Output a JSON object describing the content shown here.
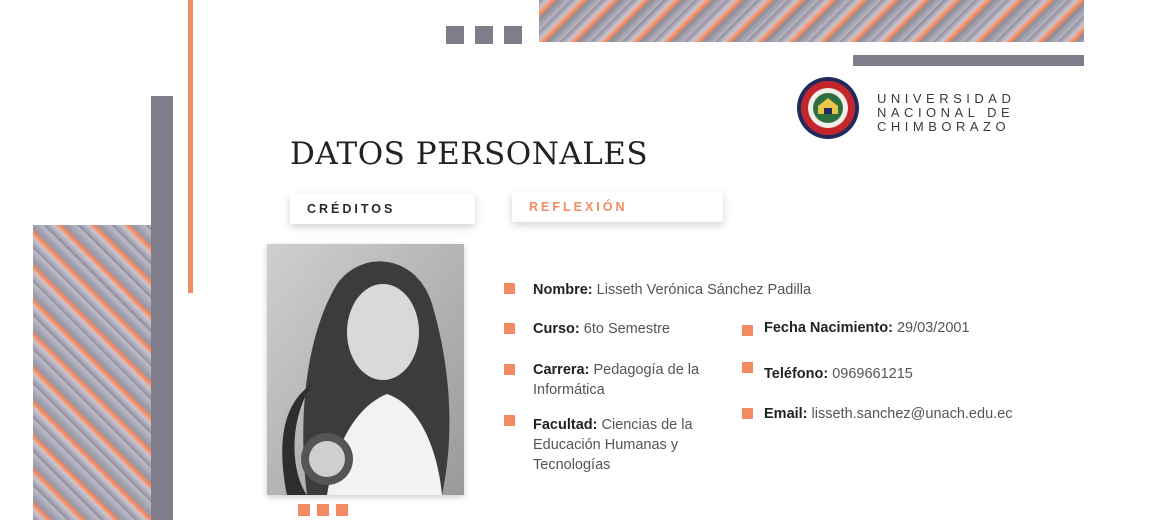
{
  "header": {
    "title": "DATOS PERSONALES",
    "university_line1": "UNIVERSIDAD",
    "university_line2": "NACIONAL DE",
    "university_line3": "CHIMBORAZO",
    "logo_icon": "university-seal-icon"
  },
  "tabs": [
    {
      "label": "CRÉDITOS",
      "active": false
    },
    {
      "label": "REFLEXIÓN",
      "active": true
    }
  ],
  "profile": {
    "photo_icon": "profile-photo",
    "left_fields": [
      {
        "label": "Nombre:",
        "value": "Lisseth Verónica Sánchez Padilla"
      },
      {
        "label": "Curso:",
        "value": "6to Semestre"
      },
      {
        "label": "Carrera:",
        "value": "Pedagogía de la Informática"
      },
      {
        "label": "Facultad:",
        "value": "Ciencias de la Educación Humanas y Tecnologías"
      }
    ],
    "right_fields": [
      {
        "label": "Fecha Nacimiento:",
        "value": "29/03/2001"
      },
      {
        "label": "Teléfono:",
        "value": "0969661215"
      },
      {
        "label": "Email:",
        "value": "lisseth.sanchez@unach.edu.ec"
      }
    ]
  },
  "colors": {
    "accent": "#f28b62",
    "gray": "#7e7d89",
    "tab_active": "#f28b62"
  }
}
